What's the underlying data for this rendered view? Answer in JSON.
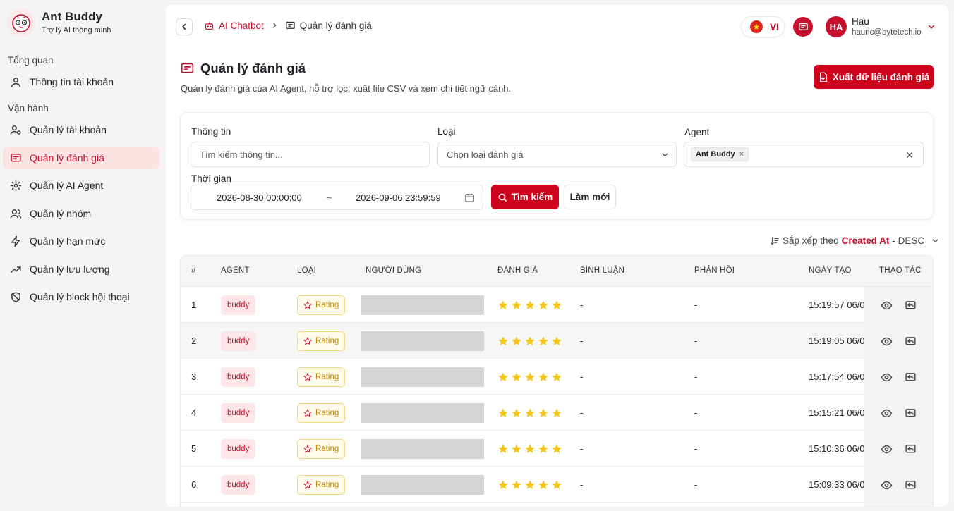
{
  "brand": {
    "name": "Ant Buddy",
    "subtitle": "Trợ lý AI thông minh"
  },
  "sidebar": {
    "sections": [
      {
        "title": "Tổng quan"
      },
      {
        "title": "Vận hành"
      }
    ],
    "items": [
      {
        "label": "Thông tin tài khoản",
        "icon": "user-icon"
      },
      {
        "label": "Quản lý tài khoản",
        "icon": "users-gear-icon"
      },
      {
        "label": "Quản lý đánh giá",
        "icon": "message-square-icon",
        "active": true
      },
      {
        "label": "Quản lý AI Agent",
        "icon": "settings-icon"
      },
      {
        "label": "Quản lý nhóm",
        "icon": "users-icon"
      },
      {
        "label": "Quản lý hạn mức",
        "icon": "zap-icon"
      },
      {
        "label": "Quản lý lưu lượng",
        "icon": "trending-up-icon"
      },
      {
        "label": "Quản lý block hội thoại",
        "icon": "ban-icon"
      }
    ]
  },
  "header": {
    "breadcrumbs": [
      {
        "label": "AI Chatbot",
        "icon": "bot-icon"
      },
      {
        "label": "Quản lý đánh giá",
        "icon": "message-square-icon"
      }
    ],
    "language": "VI",
    "user": {
      "initials": "HA",
      "name": "Hau",
      "email": "haunc@bytetech.io"
    }
  },
  "page": {
    "title": "Quản lý đánh giá",
    "description": "Quản lý đánh giá của AI Agent, hỗ trợ lọc, xuất file CSV và xem chi tiết ngữ cảnh.",
    "export_label": "Xuất dữ liệu đánh giá"
  },
  "filters": {
    "info_label": "Thông tin",
    "info_placeholder": "Tìm kiếm thông tin...",
    "type_label": "Loại",
    "type_placeholder": "Chọn loại đánh giá",
    "agent_label": "Agent",
    "agent_tag": "Ant Buddy",
    "time_label": "Thời gian",
    "time_start": "2026-08-30 00:00:00",
    "time_separator": "~",
    "time_end": "2026-09-06 23:59:59",
    "search_label": "Tìm kiếm",
    "reset_label": "Làm mới"
  },
  "sort": {
    "prefix": "Sắp xếp theo",
    "field": "Created At",
    "order": "- DESC"
  },
  "table": {
    "columns": [
      "#",
      "AGENT",
      "LOẠI",
      "NGƯỜI DÙNG",
      "ĐÁNH GIÁ",
      "BÌNH LUẬN",
      "PHẢN HỒI",
      "NGÀY TẠO",
      "THAO TÁC"
    ],
    "rows": [
      {
        "index": "1",
        "agent": "buddy",
        "type": "Rating",
        "rating": 5,
        "comment": "-",
        "feedback": "-",
        "created": "15:19:57 06/0"
      },
      {
        "index": "2",
        "agent": "buddy",
        "type": "Rating",
        "rating": 5,
        "comment": "-",
        "feedback": "-",
        "created": "15:19:05 06/0"
      },
      {
        "index": "3",
        "agent": "buddy",
        "type": "Rating",
        "rating": 5,
        "comment": "-",
        "feedback": "-",
        "created": "15:17:54 06/0"
      },
      {
        "index": "4",
        "agent": "buddy",
        "type": "Rating",
        "rating": 5,
        "comment": "-",
        "feedback": "-",
        "created": "15:15:21 06/0"
      },
      {
        "index": "5",
        "agent": "buddy",
        "type": "Rating",
        "rating": 5,
        "comment": "-",
        "feedback": "-",
        "created": "15:10:36 06/0"
      },
      {
        "index": "6",
        "agent": "buddy",
        "type": "Rating",
        "rating": 5,
        "comment": "-",
        "feedback": "-",
        "created": "15:09:33 06/0"
      }
    ]
  },
  "colors": {
    "accent": "#c8102e",
    "star": "#f5c518"
  }
}
